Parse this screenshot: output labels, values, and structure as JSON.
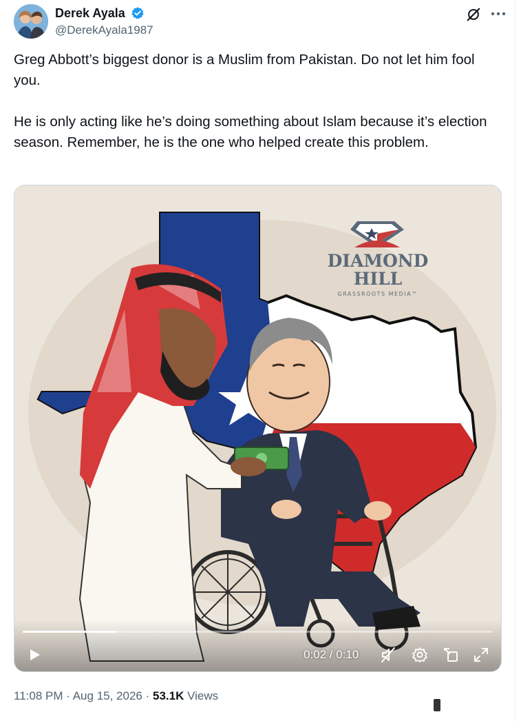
{
  "author": {
    "display_name": "Derek Ayala",
    "handle": "@DerekAyala1987",
    "verified_color": "#1d9bf0"
  },
  "tweet": {
    "paragraphs": [
      "Greg Abbott’s biggest donor is a Muslim from Pakistan. Do not let him fool you.",
      "He is only acting like he’s doing something about Islam because it’s election season. Remember, he is the one who helped create this problem."
    ]
  },
  "media": {
    "watermark": {
      "line1": "DIAMOND",
      "line2": "HILL",
      "tagline": "GRASSROOTS MEDIA™"
    },
    "player": {
      "time_display": "0:02 / 0:10",
      "progress": 0.2,
      "muted": true
    }
  },
  "meta": {
    "time": "11:08 PM",
    "separator": "·",
    "date": "Aug 15, 2026",
    "views_count": "53.1K",
    "views_label": "Views"
  },
  "icons": {
    "verified": "verified-badge-icon",
    "grok": "grok-icon",
    "more": "more-icon",
    "play": "play-icon",
    "mute": "mute-icon",
    "settings": "gear-icon",
    "pip": "pip-icon",
    "fullscreen": "fullscreen-icon"
  },
  "colors": {
    "text_primary": "#0f1419",
    "text_secondary": "#536471",
    "texas_blue": "#1f3f8f",
    "texas_red": "#cf2b2b"
  }
}
